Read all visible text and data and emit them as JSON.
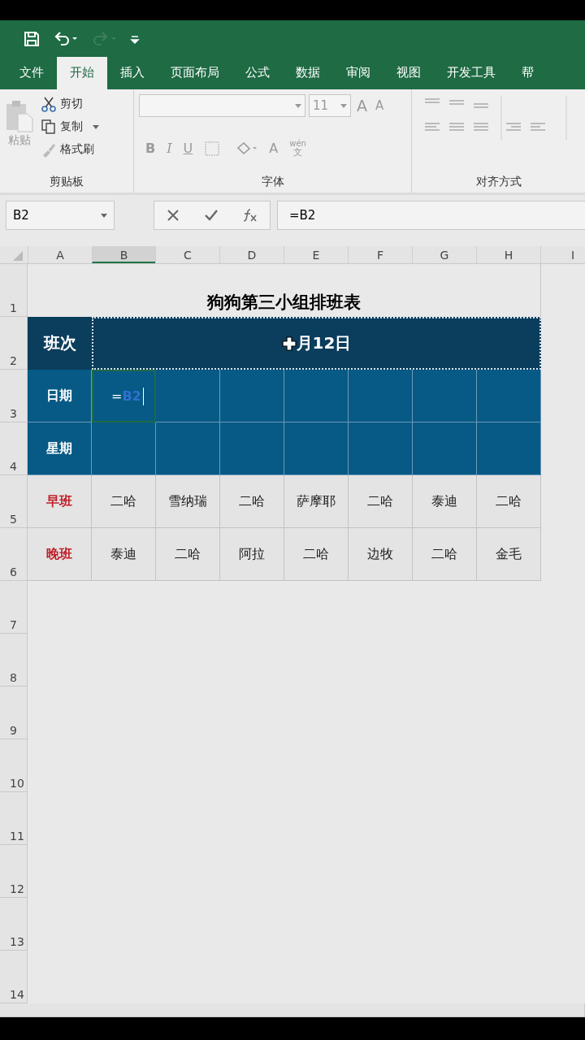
{
  "tabs": [
    {
      "label": "文件",
      "selected": false
    },
    {
      "label": "开始",
      "selected": true
    },
    {
      "label": "插入",
      "selected": false
    },
    {
      "label": "页面布局",
      "selected": false
    },
    {
      "label": "公式",
      "selected": false
    },
    {
      "label": "数据",
      "selected": false
    },
    {
      "label": "审阅",
      "selected": false
    },
    {
      "label": "视图",
      "selected": false
    },
    {
      "label": "开发工具",
      "selected": false
    },
    {
      "label": "帮",
      "selected": false
    }
  ],
  "ribbon": {
    "clipboard": {
      "paste": "粘贴",
      "cut": "剪切",
      "copy": "复制",
      "format_painter": "格式刷",
      "label": "剪贴板"
    },
    "font": {
      "font_size": "11",
      "grow": "A",
      "shrink": "A",
      "bold": "B",
      "italic": "I",
      "underline": "U",
      "font_color": "A",
      "phonetic": "wén",
      "phonetic_base": "文",
      "label": "字体"
    },
    "alignment": {
      "label": "对齐方式"
    }
  },
  "formula_bar": {
    "name_box": "B2",
    "formula": "=B2"
  },
  "columns": [
    {
      "label": "A",
      "selected": false
    },
    {
      "label": "B",
      "selected": true
    },
    {
      "label": "C",
      "selected": false
    },
    {
      "label": "D",
      "selected": false
    },
    {
      "label": "E",
      "selected": false
    },
    {
      "label": "F",
      "selected": false
    },
    {
      "label": "G",
      "selected": false
    },
    {
      "label": "H",
      "selected": false
    },
    {
      "label": "I",
      "selected": false
    }
  ],
  "row_numbers": [
    "1",
    "2",
    "3",
    "4",
    "5",
    "6",
    "7",
    "8",
    "9",
    "10",
    "11",
    "12",
    "13",
    "14"
  ],
  "sheet": {
    "title": "狗狗第三小组排班表",
    "shift_header": {
      "label": "班次",
      "value": "月12日"
    },
    "header_rows": [
      {
        "label": "日期",
        "editing": {
          "prefix": "=",
          "ref": "B2"
        }
      },
      {
        "label": "星期"
      }
    ],
    "shift_rows": [
      {
        "label": "早班",
        "cells": [
          "二哈",
          "雪纳瑞",
          "二哈",
          "萨摩耶",
          "二哈",
          "泰迪",
          "二哈"
        ]
      },
      {
        "label": "晚班",
        "cells": [
          "泰迪",
          "二哈",
          "阿拉",
          "二哈",
          "边牧",
          "二哈",
          "金毛"
        ]
      }
    ]
  }
}
